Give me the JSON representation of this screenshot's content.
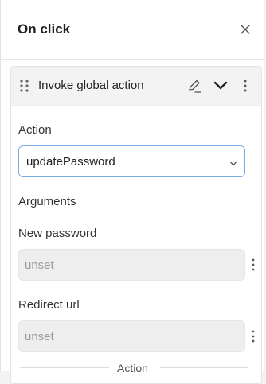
{
  "panel": {
    "title": "On click",
    "close_icon": "close-icon"
  },
  "action_card": {
    "title": "Invoke global action",
    "icons": [
      "drag-handle-icon",
      "edit-icon",
      "chevron-down-icon",
      "more-vertical-icon"
    ],
    "action_label": "Action",
    "action_value": "updatePassword",
    "arguments_label": "Arguments",
    "fields": [
      {
        "label": "New password",
        "placeholder": "unset"
      },
      {
        "label": "Redirect url",
        "placeholder": "unset"
      }
    ]
  },
  "footer": {
    "section_label": "Action"
  },
  "colors": {
    "focus_border": "#7aaee6",
    "card_header_bg": "#f3f3f3",
    "input_bg": "#eeeeee",
    "placeholder": "#9b9b9b"
  }
}
